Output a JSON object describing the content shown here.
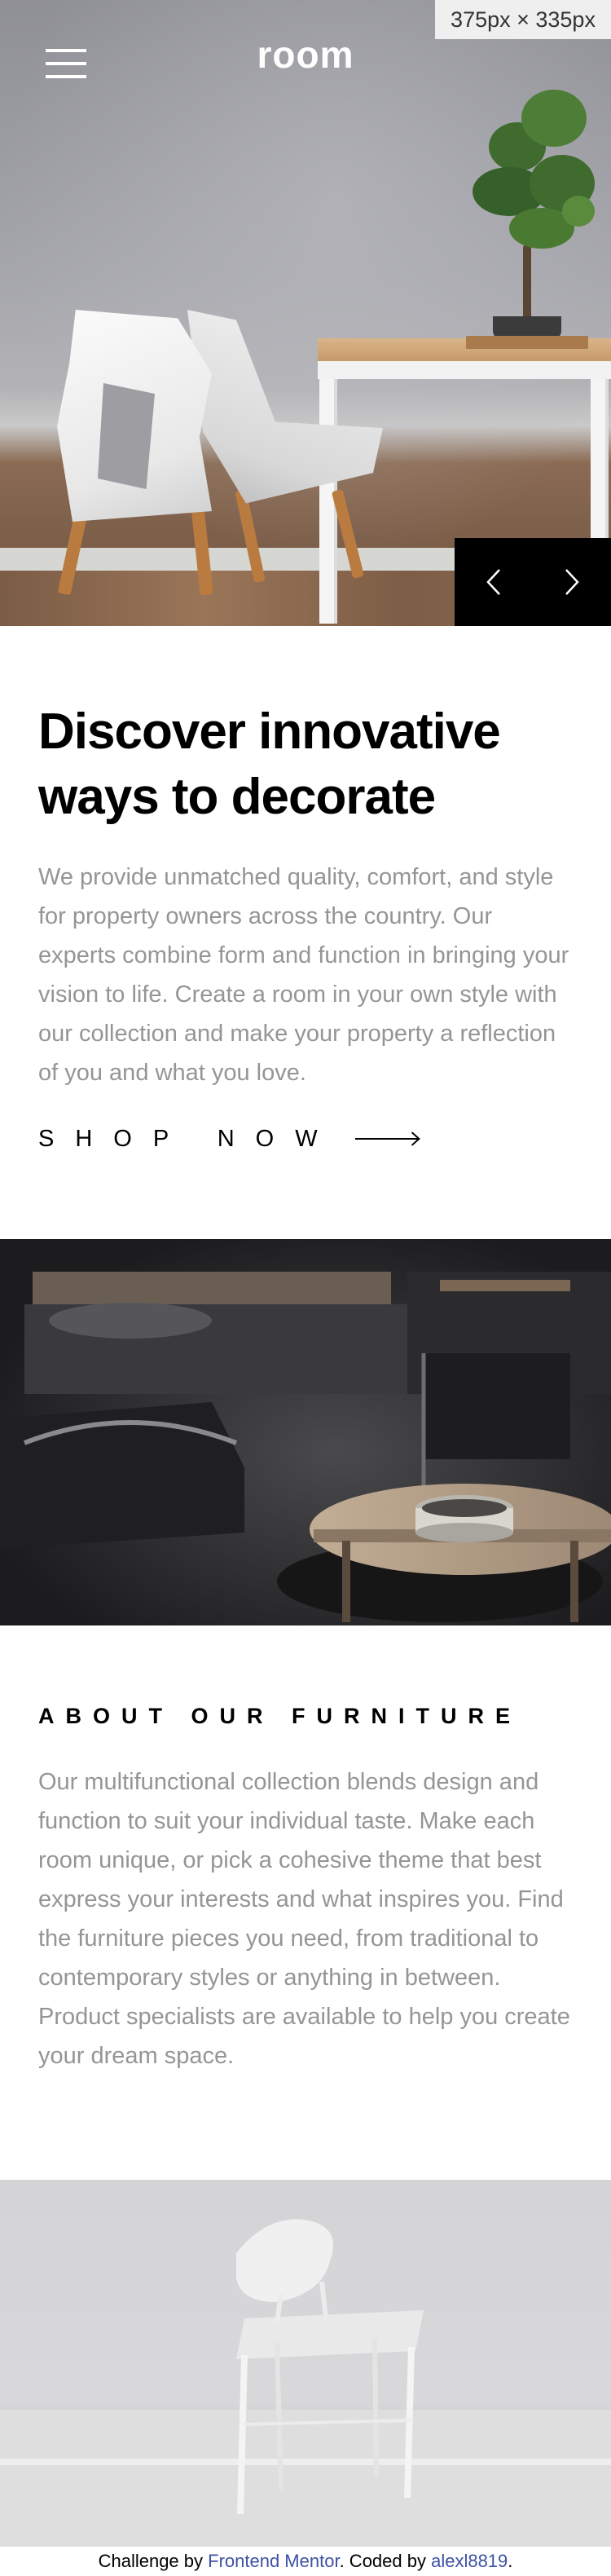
{
  "header": {
    "logo": "room",
    "menu_icon": "hamburger-menu-icon",
    "viewport_badge": "375px × 335px"
  },
  "slider": {
    "prev_icon": "chevron-left-icon",
    "next_icon": "chevron-right-icon"
  },
  "discover": {
    "title": "Discover innovative ways to decorate",
    "body": "We provide unmatched quality, comfort, and style for property owners across the country. Our experts combine form and function in bringing your vision to life. Create a room in your own style with our collection and make your property a reflection of you and what you love.",
    "cta_label": "SHOP NOW",
    "cta_icon": "arrow-right-icon"
  },
  "about": {
    "title": "ABOUT OUR FURNITURE",
    "body": "Our multifunctional collection blends design and function to suit your individual taste. Make each room unique, or pick a cohesive theme that best express your interests and what inspires you. Find the furniture pieces you need, from traditional to contemporary styles or anything in between. Product specialists are available to help you create your dream space."
  },
  "footer": {
    "prefix": "Challenge by ",
    "link1": "Frontend Mentor",
    "middle": ". Coded by ",
    "link2": "alexl8819",
    "suffix": "."
  },
  "colors": {
    "accent_dark": "#000000",
    "body_text": "#959595",
    "link": "#3e52a3"
  }
}
